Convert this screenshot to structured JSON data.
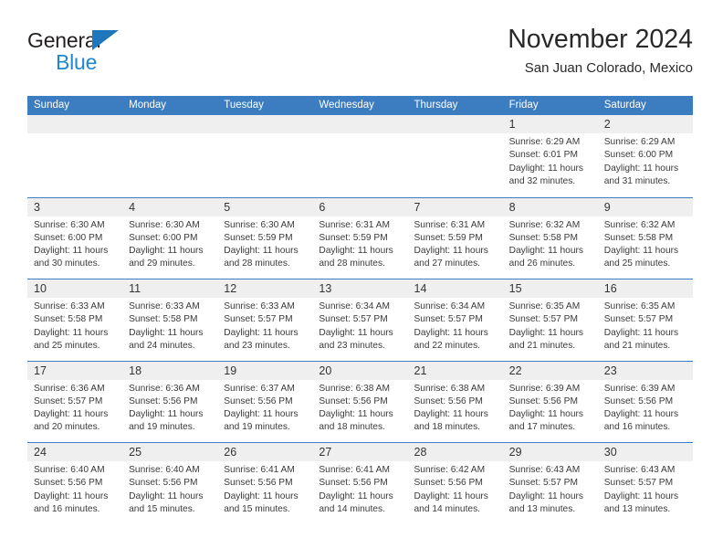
{
  "brand": {
    "name_part1": "General",
    "name_part2": "Blue",
    "triangle_color": "#1f76bd",
    "text_color_1": "#231f20",
    "text_color_2": "#1f86d0"
  },
  "header": {
    "title": "November 2024",
    "subtitle": "San Juan Colorado, Mexico"
  },
  "theme": {
    "header_bg": "#3b7dc0",
    "band_bg": "#efefef",
    "row_divider": "#3b7dc0",
    "text": "#3a3a3a"
  },
  "weekdays": [
    {
      "label": "Sunday"
    },
    {
      "label": "Monday"
    },
    {
      "label": "Tuesday"
    },
    {
      "label": "Wednesday"
    },
    {
      "label": "Thursday"
    },
    {
      "label": "Friday"
    },
    {
      "label": "Saturday"
    }
  ],
  "weeks": [
    {
      "days": [
        {
          "num": "",
          "empty": true,
          "sunrise": "",
          "sunset": "",
          "daylight_line1": "",
          "daylight_line2": ""
        },
        {
          "num": "",
          "empty": true,
          "sunrise": "",
          "sunset": "",
          "daylight_line1": "",
          "daylight_line2": ""
        },
        {
          "num": "",
          "empty": true,
          "sunrise": "",
          "sunset": "",
          "daylight_line1": "",
          "daylight_line2": ""
        },
        {
          "num": "",
          "empty": true,
          "sunrise": "",
          "sunset": "",
          "daylight_line1": "",
          "daylight_line2": ""
        },
        {
          "num": "",
          "empty": true,
          "sunrise": "",
          "sunset": "",
          "daylight_line1": "",
          "daylight_line2": ""
        },
        {
          "num": "1",
          "empty": false,
          "sunrise": "Sunrise: 6:29 AM",
          "sunset": "Sunset: 6:01 PM",
          "daylight_line1": "Daylight: 11 hours",
          "daylight_line2": "and 32 minutes."
        },
        {
          "num": "2",
          "empty": false,
          "sunrise": "Sunrise: 6:29 AM",
          "sunset": "Sunset: 6:00 PM",
          "daylight_line1": "Daylight: 11 hours",
          "daylight_line2": "and 31 minutes."
        }
      ]
    },
    {
      "days": [
        {
          "num": "3",
          "empty": false,
          "sunrise": "Sunrise: 6:30 AM",
          "sunset": "Sunset: 6:00 PM",
          "daylight_line1": "Daylight: 11 hours",
          "daylight_line2": "and 30 minutes."
        },
        {
          "num": "4",
          "empty": false,
          "sunrise": "Sunrise: 6:30 AM",
          "sunset": "Sunset: 6:00 PM",
          "daylight_line1": "Daylight: 11 hours",
          "daylight_line2": "and 29 minutes."
        },
        {
          "num": "5",
          "empty": false,
          "sunrise": "Sunrise: 6:30 AM",
          "sunset": "Sunset: 5:59 PM",
          "daylight_line1": "Daylight: 11 hours",
          "daylight_line2": "and 28 minutes."
        },
        {
          "num": "6",
          "empty": false,
          "sunrise": "Sunrise: 6:31 AM",
          "sunset": "Sunset: 5:59 PM",
          "daylight_line1": "Daylight: 11 hours",
          "daylight_line2": "and 28 minutes."
        },
        {
          "num": "7",
          "empty": false,
          "sunrise": "Sunrise: 6:31 AM",
          "sunset": "Sunset: 5:59 PM",
          "daylight_line1": "Daylight: 11 hours",
          "daylight_line2": "and 27 minutes."
        },
        {
          "num": "8",
          "empty": false,
          "sunrise": "Sunrise: 6:32 AM",
          "sunset": "Sunset: 5:58 PM",
          "daylight_line1": "Daylight: 11 hours",
          "daylight_line2": "and 26 minutes."
        },
        {
          "num": "9",
          "empty": false,
          "sunrise": "Sunrise: 6:32 AM",
          "sunset": "Sunset: 5:58 PM",
          "daylight_line1": "Daylight: 11 hours",
          "daylight_line2": "and 25 minutes."
        }
      ]
    },
    {
      "days": [
        {
          "num": "10",
          "empty": false,
          "sunrise": "Sunrise: 6:33 AM",
          "sunset": "Sunset: 5:58 PM",
          "daylight_line1": "Daylight: 11 hours",
          "daylight_line2": "and 25 minutes."
        },
        {
          "num": "11",
          "empty": false,
          "sunrise": "Sunrise: 6:33 AM",
          "sunset": "Sunset: 5:58 PM",
          "daylight_line1": "Daylight: 11 hours",
          "daylight_line2": "and 24 minutes."
        },
        {
          "num": "12",
          "empty": false,
          "sunrise": "Sunrise: 6:33 AM",
          "sunset": "Sunset: 5:57 PM",
          "daylight_line1": "Daylight: 11 hours",
          "daylight_line2": "and 23 minutes."
        },
        {
          "num": "13",
          "empty": false,
          "sunrise": "Sunrise: 6:34 AM",
          "sunset": "Sunset: 5:57 PM",
          "daylight_line1": "Daylight: 11 hours",
          "daylight_line2": "and 23 minutes."
        },
        {
          "num": "14",
          "empty": false,
          "sunrise": "Sunrise: 6:34 AM",
          "sunset": "Sunset: 5:57 PM",
          "daylight_line1": "Daylight: 11 hours",
          "daylight_line2": "and 22 minutes."
        },
        {
          "num": "15",
          "empty": false,
          "sunrise": "Sunrise: 6:35 AM",
          "sunset": "Sunset: 5:57 PM",
          "daylight_line1": "Daylight: 11 hours",
          "daylight_line2": "and 21 minutes."
        },
        {
          "num": "16",
          "empty": false,
          "sunrise": "Sunrise: 6:35 AM",
          "sunset": "Sunset: 5:57 PM",
          "daylight_line1": "Daylight: 11 hours",
          "daylight_line2": "and 21 minutes."
        }
      ]
    },
    {
      "days": [
        {
          "num": "17",
          "empty": false,
          "sunrise": "Sunrise: 6:36 AM",
          "sunset": "Sunset: 5:57 PM",
          "daylight_line1": "Daylight: 11 hours",
          "daylight_line2": "and 20 minutes."
        },
        {
          "num": "18",
          "empty": false,
          "sunrise": "Sunrise: 6:36 AM",
          "sunset": "Sunset: 5:56 PM",
          "daylight_line1": "Daylight: 11 hours",
          "daylight_line2": "and 19 minutes."
        },
        {
          "num": "19",
          "empty": false,
          "sunrise": "Sunrise: 6:37 AM",
          "sunset": "Sunset: 5:56 PM",
          "daylight_line1": "Daylight: 11 hours",
          "daylight_line2": "and 19 minutes."
        },
        {
          "num": "20",
          "empty": false,
          "sunrise": "Sunrise: 6:38 AM",
          "sunset": "Sunset: 5:56 PM",
          "daylight_line1": "Daylight: 11 hours",
          "daylight_line2": "and 18 minutes."
        },
        {
          "num": "21",
          "empty": false,
          "sunrise": "Sunrise: 6:38 AM",
          "sunset": "Sunset: 5:56 PM",
          "daylight_line1": "Daylight: 11 hours",
          "daylight_line2": "and 18 minutes."
        },
        {
          "num": "22",
          "empty": false,
          "sunrise": "Sunrise: 6:39 AM",
          "sunset": "Sunset: 5:56 PM",
          "daylight_line1": "Daylight: 11 hours",
          "daylight_line2": "and 17 minutes."
        },
        {
          "num": "23",
          "empty": false,
          "sunrise": "Sunrise: 6:39 AM",
          "sunset": "Sunset: 5:56 PM",
          "daylight_line1": "Daylight: 11 hours",
          "daylight_line2": "and 16 minutes."
        }
      ]
    },
    {
      "days": [
        {
          "num": "24",
          "empty": false,
          "sunrise": "Sunrise: 6:40 AM",
          "sunset": "Sunset: 5:56 PM",
          "daylight_line1": "Daylight: 11 hours",
          "daylight_line2": "and 16 minutes."
        },
        {
          "num": "25",
          "empty": false,
          "sunrise": "Sunrise: 6:40 AM",
          "sunset": "Sunset: 5:56 PM",
          "daylight_line1": "Daylight: 11 hours",
          "daylight_line2": "and 15 minutes."
        },
        {
          "num": "26",
          "empty": false,
          "sunrise": "Sunrise: 6:41 AM",
          "sunset": "Sunset: 5:56 PM",
          "daylight_line1": "Daylight: 11 hours",
          "daylight_line2": "and 15 minutes."
        },
        {
          "num": "27",
          "empty": false,
          "sunrise": "Sunrise: 6:41 AM",
          "sunset": "Sunset: 5:56 PM",
          "daylight_line1": "Daylight: 11 hours",
          "daylight_line2": "and 14 minutes."
        },
        {
          "num": "28",
          "empty": false,
          "sunrise": "Sunrise: 6:42 AM",
          "sunset": "Sunset: 5:56 PM",
          "daylight_line1": "Daylight: 11 hours",
          "daylight_line2": "and 14 minutes."
        },
        {
          "num": "29",
          "empty": false,
          "sunrise": "Sunrise: 6:43 AM",
          "sunset": "Sunset: 5:57 PM",
          "daylight_line1": "Daylight: 11 hours",
          "daylight_line2": "and 13 minutes."
        },
        {
          "num": "30",
          "empty": false,
          "sunrise": "Sunrise: 6:43 AM",
          "sunset": "Sunset: 5:57 PM",
          "daylight_line1": "Daylight: 11 hours",
          "daylight_line2": "and 13 minutes."
        }
      ]
    }
  ]
}
